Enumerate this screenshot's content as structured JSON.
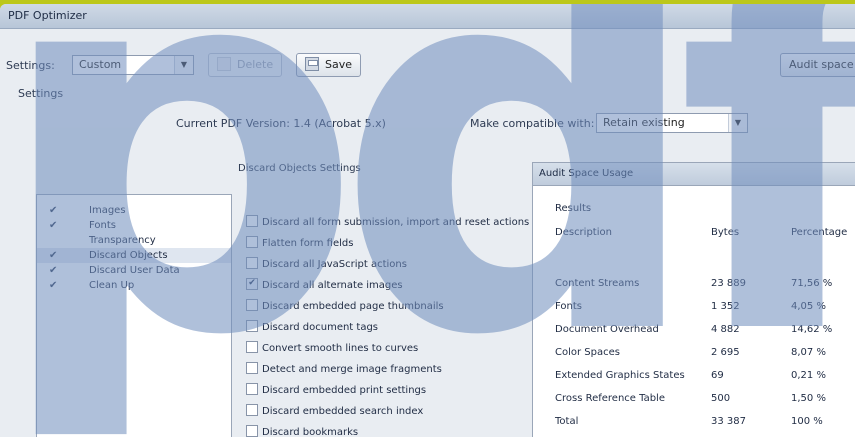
{
  "window": {
    "title": "PDF Optimizer"
  },
  "toolbar": {
    "settings_label": "Settings:",
    "settings_value": "Custom",
    "delete_label": "Delete",
    "save_label": "Save",
    "audit_label": "Audit space usage"
  },
  "settings_heading": "Settings",
  "version_text": "Current PDF Version: 1.4 (Acrobat 5.x)",
  "compat": {
    "label": "Make compatible with:",
    "value": "Retain existing"
  },
  "categories": [
    {
      "label": "Images",
      "checked": true
    },
    {
      "label": "Fonts",
      "checked": true
    },
    {
      "label": "Transparency",
      "checked": false
    },
    {
      "label": "Discard Objects",
      "checked": true
    },
    {
      "label": "Discard User Data",
      "checked": true
    },
    {
      "label": "Clean Up",
      "checked": true
    }
  ],
  "discard": {
    "heading": "Discard Objects Settings",
    "options": [
      {
        "label": "Discard all form submission, import and reset actions",
        "checked": false
      },
      {
        "label": "Flatten form fields",
        "checked": false
      },
      {
        "label": "Discard all JavaScript actions",
        "checked": false
      },
      {
        "label": "Discard all alternate images",
        "checked": true
      },
      {
        "label": "Discard embedded page thumbnails",
        "checked": false
      },
      {
        "label": "Discard document tags",
        "checked": false
      },
      {
        "label": "Convert smooth lines to curves",
        "checked": false
      },
      {
        "label": "Detect and merge image fragments",
        "checked": false
      },
      {
        "label": "Discard embedded print settings",
        "checked": false
      },
      {
        "label": "Discard embedded search index",
        "checked": false
      },
      {
        "label": "Discard bookmarks",
        "checked": false
      }
    ]
  },
  "audit": {
    "title": "Audit Space Usage",
    "results_label": "Results",
    "columns": [
      "Description",
      "Bytes",
      "Percentage"
    ],
    "rows": [
      [
        "Content Streams",
        "23 889",
        "71,56 %"
      ],
      [
        "Fonts",
        "1 352",
        "4,05 %"
      ],
      [
        "Document Overhead",
        "4 882",
        "14,62 %"
      ],
      [
        "Color Spaces",
        "2 695",
        "8,07 %"
      ],
      [
        "Extended Graphics States",
        "69",
        "0,21 %"
      ],
      [
        "Cross Reference Table",
        "500",
        "1,50 %"
      ],
      [
        "Total",
        "33 387",
        "100 %"
      ]
    ]
  },
  "watermark": {
    "text": "pdf"
  },
  "colors": {
    "frame": "#bcc71a",
    "watermark": "#6f8dbd"
  }
}
